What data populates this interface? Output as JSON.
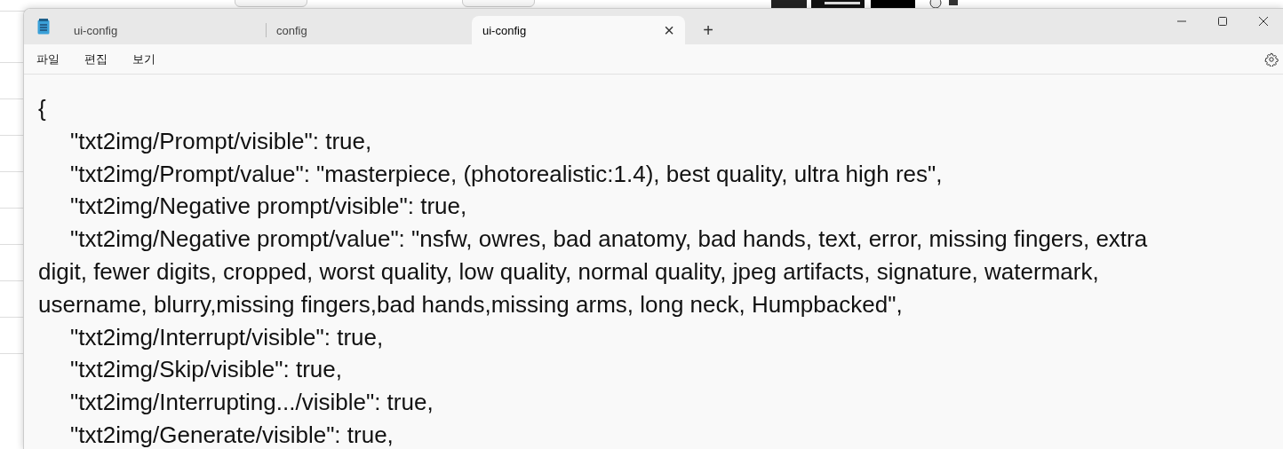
{
  "window": {
    "tabs": [
      {
        "label": "ui-config",
        "selected": false
      },
      {
        "label": "config",
        "selected": false
      },
      {
        "label": "ui-config",
        "selected": true,
        "close": "×"
      }
    ],
    "new_tab": "+",
    "menu": [
      "파일",
      "편집",
      "보기"
    ],
    "lines": [
      {
        "text": "{",
        "indent": false
      },
      {
        "text": "\"txt2img/Prompt/visible\": true,",
        "indent": true
      },
      {
        "text": "\"txt2img/Prompt/value\": \"masterpiece, (photorealistic:1.4), best quality, ultra high res\",",
        "indent": true
      },
      {
        "text": "\"txt2img/Negative prompt/visible\": true,",
        "indent": true
      },
      {
        "text": "\"txt2img/Negative prompt/value\": \"nsfw, owres, bad anatomy, bad hands, text, error, missing fingers, extra digit, fewer digits, cropped, worst quality, low quality, normal quality, jpeg artifacts, signature, watermark, username, blurry,missing fingers,bad hands,missing arms, long neck, Humpbacked\",",
        "indent": true
      },
      {
        "text": "\"txt2img/Interrupt/visible\": true,",
        "indent": true
      },
      {
        "text": "\"txt2img/Skip/visible\": true,",
        "indent": true
      },
      {
        "text": "\"txt2img/Interrupting.../visible\": true,",
        "indent": true
      },
      {
        "text": "\"txt2img/Generate/visible\": true,",
        "indent": true
      }
    ]
  }
}
